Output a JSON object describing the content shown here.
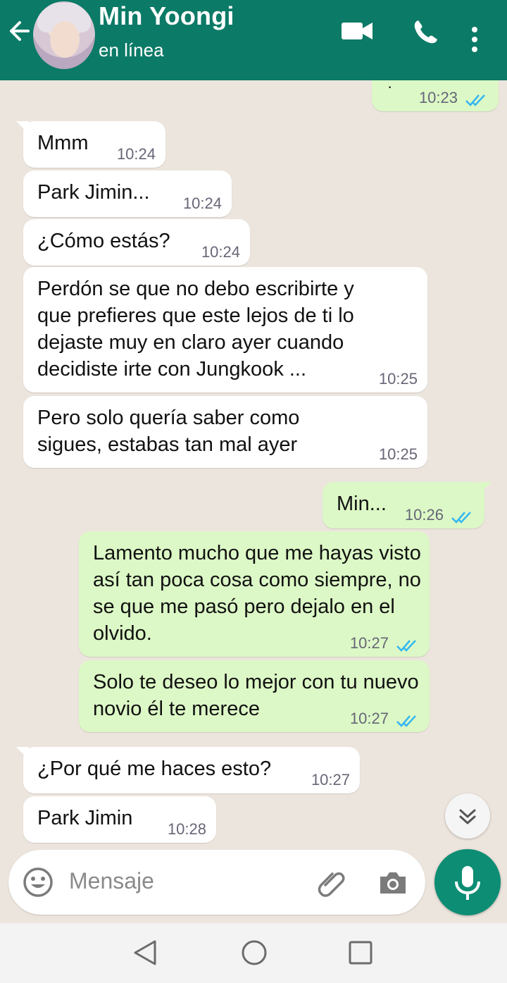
{
  "header": {
    "contact_name": "Min Yoongi",
    "status": "en línea",
    "icons": [
      "back-arrow-icon",
      "video-call-icon",
      "phone-call-icon",
      "more-options-icon"
    ]
  },
  "messages": [
    {
      "dir": "out",
      "text": "·",
      "time": "10:23",
      "read": true
    },
    {
      "dir": "in",
      "text": "Mmm",
      "time": "10:24"
    },
    {
      "dir": "in",
      "text": "Park Jimin...",
      "time": "10:24"
    },
    {
      "dir": "in",
      "text": "¿Cómo estás?",
      "time": "10:24"
    },
    {
      "dir": "in",
      "text": "Perdón se que no debo escribirte y que prefieres que este lejos de ti lo dejaste muy en claro ayer cuando decidiste irte con Jungkook ...",
      "time": "10:25"
    },
    {
      "dir": "in",
      "text": "Pero solo quería saber como sigues, estabas tan mal ayer",
      "time": "10:25"
    },
    {
      "dir": "out",
      "text": "Min...",
      "time": "10:26",
      "read": true
    },
    {
      "dir": "out",
      "text": "Lamento mucho que me hayas visto así tan poca cosa como siempre, no se que me pasó pero dejalo en el olvido.",
      "time": "10:27",
      "read": true
    },
    {
      "dir": "out",
      "text": "Solo te deseo lo mejor con tu nuevo novio él te merece",
      "time": "10:27",
      "read": true
    },
    {
      "dir": "in",
      "text": "¿Por qué me haces esto?",
      "time": "10:27"
    },
    {
      "dir": "in",
      "text": "Park Jimin",
      "time": "10:28"
    }
  ],
  "composer": {
    "placeholder": "Mensaje",
    "icons": [
      "emoji-icon",
      "attach-icon",
      "camera-icon",
      "mic-icon"
    ]
  },
  "colors": {
    "header": "#0b7a66",
    "outgoing_bubble": "#dcf8c6",
    "incoming_bubble": "#ffffff",
    "chat_background": "#ece5dd",
    "read_ticks": "#34b7f1",
    "mic_button": "#0c8d74"
  },
  "navbar": {
    "icons": [
      "nav-back-icon",
      "nav-home-icon",
      "nav-recents-icon"
    ]
  }
}
